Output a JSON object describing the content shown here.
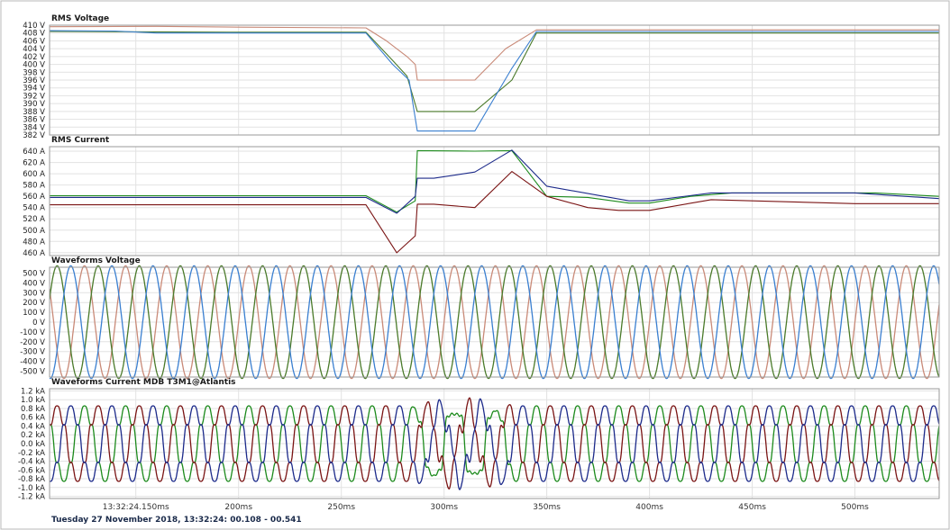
{
  "colors": {
    "voltage_l1": "#c98a78",
    "voltage_l2": "#4a7a2a",
    "voltage_l3": "#3a7fd0",
    "current_l1": "#1c8a1c",
    "current_l2": "#1c2a8a",
    "current_l3": "#7a1414",
    "grid": "#e2e2e2",
    "border": "#9a9a9a"
  },
  "x_axis": {
    "ticks": [
      {
        "t": 150,
        "label": "13:32:24.150ms"
      },
      {
        "t": 200,
        "label": "200ms"
      },
      {
        "t": 250,
        "label": "250ms"
      },
      {
        "t": 300,
        "label": "300ms"
      },
      {
        "t": 350,
        "label": "350ms"
      },
      {
        "t": 400,
        "label": "400ms"
      },
      {
        "t": 450,
        "label": "450ms"
      },
      {
        "t": 500,
        "label": "500ms"
      }
    ],
    "range": [
      108,
      541
    ]
  },
  "footer": {
    "text": "Tuesday 27 November 2018, 13:32:24: 00.108 - 00.541"
  },
  "chart_data": [
    {
      "type": "line",
      "title": "RMS Voltage",
      "ylim": [
        382,
        410
      ],
      "y_ticks": [
        {
          "v": 410,
          "label": "410 V"
        },
        {
          "v": 408,
          "label": "408 V"
        },
        {
          "v": 406,
          "label": "406 V"
        },
        {
          "v": 404,
          "label": "404 V"
        },
        {
          "v": 402,
          "label": "402 V"
        },
        {
          "v": 400,
          "label": "400 V"
        },
        {
          "v": 398,
          "label": "398 V"
        },
        {
          "v": 396,
          "label": "396 V"
        },
        {
          "v": 394,
          "label": "394 V"
        },
        {
          "v": 392,
          "label": "392 V"
        },
        {
          "v": 390,
          "label": "390 V"
        },
        {
          "v": 388,
          "label": "388 V"
        },
        {
          "v": 386,
          "label": "386 V"
        },
        {
          "v": 384,
          "label": "384 V"
        },
        {
          "v": 382,
          "label": "382 V"
        }
      ],
      "series": [
        {
          "color": "#c98a78",
          "points": [
            [
              108,
              409.6
            ],
            [
              160,
              409.7
            ],
            [
              200,
              409.5
            ],
            [
              262,
              409.3
            ],
            [
              272,
              406
            ],
            [
              282,
              402
            ],
            [
              286,
              400
            ],
            [
              287,
              396
            ],
            [
              315,
              396
            ],
            [
              330,
              404
            ],
            [
              345,
              408.8
            ],
            [
              541,
              408.8
            ]
          ]
        },
        {
          "color": "#4a7a2a",
          "points": [
            [
              108,
              408.4
            ],
            [
              160,
              408.3
            ],
            [
              200,
              408.2
            ],
            [
              262,
              408.2
            ],
            [
              275,
              401
            ],
            [
              282,
              397
            ],
            [
              287,
              388
            ],
            [
              315,
              388
            ],
            [
              333,
              396
            ],
            [
              345,
              408.0
            ],
            [
              541,
              408.0
            ]
          ]
        },
        {
          "color": "#3a7fd0",
          "points": [
            [
              108,
              408.6
            ],
            [
              140,
              408.5
            ],
            [
              160,
              408.0
            ],
            [
              200,
              408.0
            ],
            [
              262,
              408.0
            ],
            [
              275,
              400
            ],
            [
              283,
              396
            ],
            [
              287,
              383
            ],
            [
              315,
              383
            ],
            [
              333,
              399
            ],
            [
              345,
              408.4
            ],
            [
              541,
              408.4
            ]
          ]
        }
      ]
    },
    {
      "type": "line",
      "title": "RMS Current",
      "ylim": [
        455,
        648
      ],
      "y_ticks": [
        {
          "v": 640,
          "label": "640 A"
        },
        {
          "v": 620,
          "label": "620 A"
        },
        {
          "v": 600,
          "label": "600 A"
        },
        {
          "v": 580,
          "label": "580 A"
        },
        {
          "v": 560,
          "label": "560 A"
        },
        {
          "v": 540,
          "label": "540 A"
        },
        {
          "v": 520,
          "label": "520 A"
        },
        {
          "v": 500,
          "label": "500 A"
        },
        {
          "v": 480,
          "label": "480 A"
        },
        {
          "v": 460,
          "label": "460 A"
        }
      ],
      "series": [
        {
          "color": "#1c8a1c",
          "points": [
            [
              108,
              561
            ],
            [
              262,
              561
            ],
            [
              277,
              532
            ],
            [
              286,
              552
            ],
            [
              287,
              641
            ],
            [
              315,
              640
            ],
            [
              333,
              641
            ],
            [
              350,
              560
            ],
            [
              370,
              558
            ],
            [
              390,
              548
            ],
            [
              400,
              548
            ],
            [
              420,
              560
            ],
            [
              440,
              566
            ],
            [
              510,
              566
            ],
            [
              541,
              560
            ]
          ]
        },
        {
          "color": "#1c2a8a",
          "points": [
            [
              108,
              558
            ],
            [
              262,
              558
            ],
            [
              277,
              530
            ],
            [
              286,
              560
            ],
            [
              287,
              592
            ],
            [
              295,
              592
            ],
            [
              315,
              603
            ],
            [
              333,
              642
            ],
            [
              350,
              578
            ],
            [
              390,
              552
            ],
            [
              400,
              552
            ],
            [
              430,
              566
            ],
            [
              500,
              566
            ],
            [
              541,
              556
            ]
          ]
        },
        {
          "color": "#7a1414",
          "points": [
            [
              108,
              545
            ],
            [
              262,
              545
            ],
            [
              277,
              460
            ],
            [
              286,
              490
            ],
            [
              287,
              546
            ],
            [
              295,
              546
            ],
            [
              315,
              540
            ],
            [
              333,
              604
            ],
            [
              350,
              560
            ],
            [
              370,
              540
            ],
            [
              385,
              535
            ],
            [
              400,
              535
            ],
            [
              430,
              554
            ],
            [
              500,
              547
            ],
            [
              541,
              547
            ]
          ]
        }
      ]
    },
    {
      "type": "line",
      "title": "Waveforms Voltage",
      "ylim": [
        -560,
        560
      ],
      "y_ticks": [
        {
          "v": 500,
          "label": "500 V"
        },
        {
          "v": 400,
          "label": "400 V"
        },
        {
          "v": 300,
          "label": "300 V"
        },
        {
          "v": 200,
          "label": "200 V"
        },
        {
          "v": 100,
          "label": "100 V"
        },
        {
          "v": 0,
          "label": "0 V"
        },
        {
          "v": -100,
          "label": "-100 V"
        },
        {
          "v": -200,
          "label": "-200 V"
        },
        {
          "v": -300,
          "label": "-300 V"
        },
        {
          "v": -400,
          "label": "-400 V"
        },
        {
          "v": -500,
          "label": "-500 V"
        }
      ],
      "frequency_hz": 50,
      "series": [
        {
          "color": "#c98a78",
          "amplitude": 575,
          "phase_deg": 0
        },
        {
          "color": "#4a7a2a",
          "amplitude": 575,
          "phase_deg": -120
        },
        {
          "color": "#3a7fd0",
          "amplitude": 575,
          "phase_deg": 120
        }
      ]
    },
    {
      "type": "line",
      "title": "Waveforms Current MDB T3M1@Atlantis",
      "ylim": [
        -1.25,
        1.25
      ],
      "y_ticks": [
        {
          "v": 1.2,
          "label": "1.2 kA"
        },
        {
          "v": 1.0,
          "label": "1.0 kA"
        },
        {
          "v": 0.8,
          "label": "0.8 kA"
        },
        {
          "v": 0.6,
          "label": "0.6 kA"
        },
        {
          "v": 0.4,
          "label": "0.4 kA"
        },
        {
          "v": 0.2,
          "label": "0.2 kA"
        },
        {
          "v": 0.0,
          "label": "0.0 kA"
        },
        {
          "v": -0.2,
          "label": "-0.2 kA"
        },
        {
          "v": -0.4,
          "label": "-0.4 kA"
        },
        {
          "v": -0.6,
          "label": "-0.6 kA"
        },
        {
          "v": -0.8,
          "label": "-0.8 kA"
        },
        {
          "v": -1.0,
          "label": "-1.0 kA"
        },
        {
          "v": -1.2,
          "label": "-1.2 kA"
        }
      ],
      "frequency_hz": 50,
      "series": [
        {
          "color": "#1c8a1c",
          "amplitude": 0.82,
          "phase_deg": 0
        },
        {
          "color": "#7a1414",
          "amplitude": 0.82,
          "phase_deg": -120
        },
        {
          "color": "#1c2a8a",
          "amplitude": 0.82,
          "phase_deg": 120
        }
      ]
    }
  ]
}
